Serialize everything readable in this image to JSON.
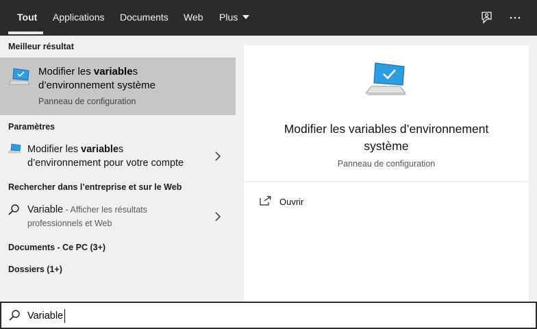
{
  "tabs": {
    "all": "Tout",
    "apps": "Applications",
    "documents": "Documents",
    "web": "Web",
    "more": "Plus"
  },
  "toolbar": {
    "feedback_icon": "feedback-icon",
    "more_icon": "ellipsis-icon"
  },
  "left": {
    "best_header": "Meilleur résultat",
    "best": {
      "line1_pre": "Modifier les ",
      "line1_bold": "variable",
      "line1_post": "s",
      "line2": "d’environnement système",
      "subtitle": "Panneau de configuration",
      "icon": "computer-monitor-icon"
    },
    "settings_header": "Paramètres",
    "setting": {
      "line1_pre": "Modifier les ",
      "line1_bold": "variable",
      "line1_post": "s",
      "line2": "d’environnement pour votre compte",
      "icon": "computer-settings-icon"
    },
    "web_header": "Rechercher dans l’entreprise et sur le Web",
    "web": {
      "query": "Variable",
      "separator": " - ",
      "desc1": "Afficher les résultats",
      "desc2": "professionnels et Web",
      "icon": "search-icon"
    },
    "docs_header": "Documents - Ce PC (3+)",
    "folders_header": "Dossiers (1+)"
  },
  "right": {
    "title_line1": "Modifier les variables d’environnement",
    "title_line2": "système",
    "subtitle": "Panneau de configuration",
    "open_label": "Ouvrir",
    "icon": "computer-monitor-icon"
  },
  "search": {
    "value": "Variable",
    "icon": "search-icon"
  },
  "colors": {
    "topbar": "#2b2b2b",
    "selected": "#c6c6c6",
    "pane": "#f0f0f0",
    "accent": "#1a8fd8"
  }
}
